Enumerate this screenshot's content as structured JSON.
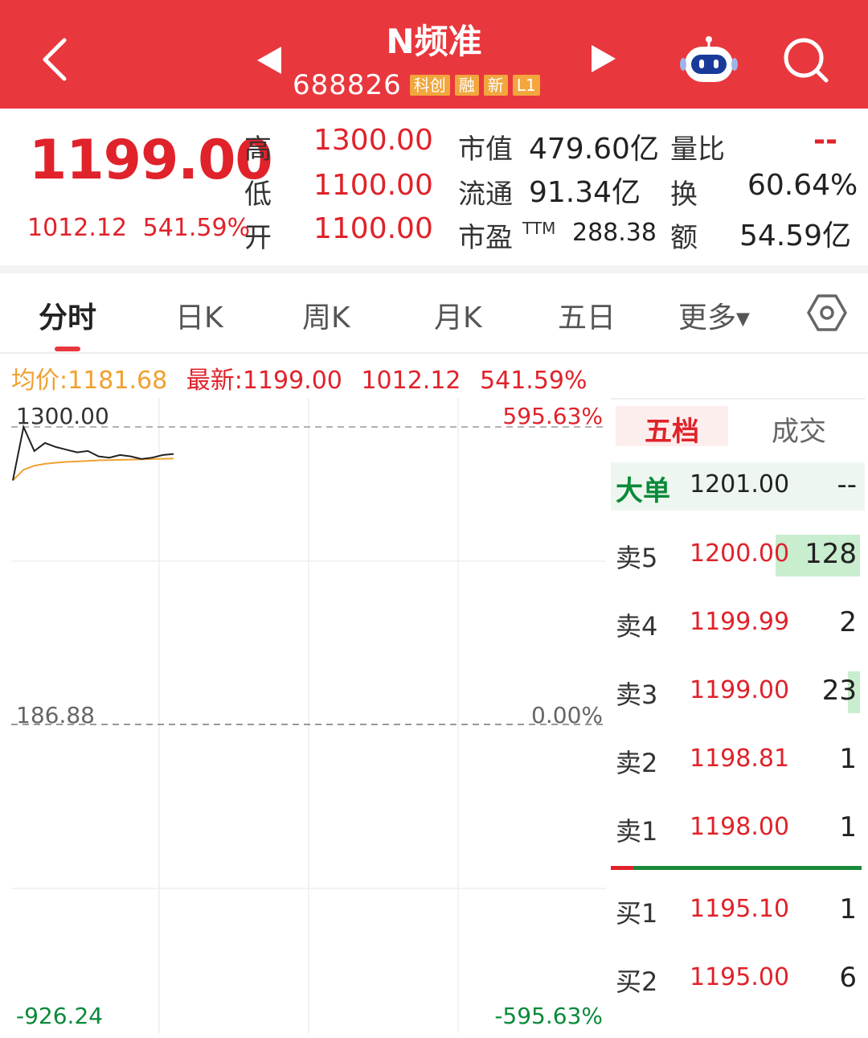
{
  "header": {
    "stock_name": "N频准",
    "stock_code": "688826",
    "tags": [
      "科创",
      "融",
      "新",
      "L1"
    ]
  },
  "quote": {
    "price": "1199.00",
    "change": "1012.12",
    "change_pct": "541.59%",
    "high_label": "高",
    "high": "1300.00",
    "low_label": "低",
    "low": "1100.00",
    "open_label": "开",
    "open": "1100.00",
    "mktcap_label": "市值",
    "mktcap": "479.60亿",
    "float_label": "流通",
    "float": "91.34亿",
    "pe_label": "市盈",
    "pe_sup": "TTM",
    "pe": "288.38",
    "volratio_label": "量比",
    "volratio": "--",
    "turnover_label": "换",
    "turnover": "60.64%",
    "amount_label": "额",
    "amount": "54.59亿"
  },
  "tabs": [
    "分时",
    "日K",
    "周K",
    "月K",
    "五日",
    "更多"
  ],
  "info": {
    "avg_label": "均价:",
    "avg": "1181.68",
    "latest_label": "最新:",
    "latest": "1199.00",
    "change": "1012.12",
    "change_pct": "541.59%"
  },
  "chart_data": {
    "type": "line",
    "y_left_top": "1300.00",
    "y_left_mid": "186.88",
    "y_left_bottom": "-926.24",
    "y_right_top": "595.63%",
    "y_right_mid": "0.00%",
    "y_right_bottom": "-595.63%",
    "ylim": [
      -926.24,
      1300.0
    ],
    "series": [
      {
        "values": [
          1100,
          1300,
          1210,
          1240,
          1225,
          1215,
          1205,
          1210,
          1190,
          1185,
          1195,
          1190,
          1180,
          1185,
          1195,
          1199
        ]
      },
      {
        "values": [
          1100,
          1140,
          1155,
          1162,
          1166,
          1169,
          1171,
          1173,
          1175,
          1176,
          1177,
          1178,
          1179,
          1180,
          1181,
          1181.68
        ]
      }
    ],
    "colors": {
      "price": "#222222",
      "avg": "#f0a030"
    }
  },
  "orderbook": {
    "tab_active": "五档",
    "tab_other": "成交",
    "big_label": "大单",
    "big_price": "1201.00",
    "big_qty": "--",
    "asks": [
      {
        "label": "卖5",
        "price": "1200.00",
        "qty": "128",
        "fill": 0.35
      },
      {
        "label": "卖4",
        "price": "1199.99",
        "qty": "2",
        "fill": 0
      },
      {
        "label": "卖3",
        "price": "1199.00",
        "qty": "23",
        "fill": 0.05
      },
      {
        "label": "卖2",
        "price": "1198.81",
        "qty": "1",
        "fill": 0
      },
      {
        "label": "卖1",
        "price": "1198.00",
        "qty": "1",
        "fill": 0
      }
    ],
    "bids": [
      {
        "label": "买1",
        "price": "1195.10",
        "qty": "1"
      },
      {
        "label": "买2",
        "price": "1195.00",
        "qty": "6"
      }
    ]
  },
  "colors": {
    "brand": "#e8383d",
    "up": "#e0222a",
    "down": "#0a8a3a",
    "avg": "#f0a030"
  }
}
